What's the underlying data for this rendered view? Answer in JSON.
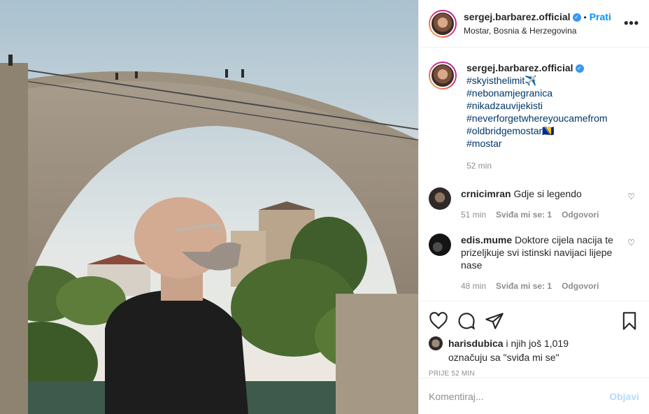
{
  "header": {
    "username": "sergej.barbarez.official",
    "verified_icon": "verified-badge-icon",
    "separator": "•",
    "follow_label": "Prati",
    "location": "Mostar, Bosnia & Herzegovina",
    "more_icon": "more-options-icon",
    "more_label": "•••"
  },
  "caption": {
    "username": "sergej.barbarez.official",
    "hashtags": [
      "#skyisthelimit✈️",
      "#nebonamjegranica",
      "#nikadzauvijekisti",
      "#neverforgetwhereyoucamefrom",
      "#oldbridgemostar🇧🇦",
      "#mostar"
    ],
    "time": "52 min"
  },
  "comments": [
    {
      "username": "crnicimran",
      "text": "Gdje si legendo",
      "time": "51 min",
      "likes": "Sviđa mi se: 1",
      "reply": "Odgovori"
    },
    {
      "username": "edis.mume",
      "text": "Doktore cijela nacija te prizeljkuje svi istinski navijaci lijepe nase",
      "time": "48 min",
      "likes": "Sviđa mi se: 1",
      "reply": "Odgovori"
    }
  ],
  "actions": {
    "like_icon": "heart-icon",
    "comment_icon": "comment-icon",
    "share_icon": "paper-plane-icon",
    "save_icon": "bookmark-icon"
  },
  "likes": {
    "user": "harisdubica",
    "rest": " i njih još 1,019",
    "line2": "označuju sa \"sviđa mi se\"",
    "time_ago": "PRIJE 52 MIN"
  },
  "add_comment": {
    "placeholder": "Komentiraj...",
    "post_label": "Objavi"
  },
  "colors": {
    "accent": "#0095f6",
    "link": "#00376b",
    "muted": "#8e8e8e",
    "post_disabled": "#b3dbff"
  }
}
